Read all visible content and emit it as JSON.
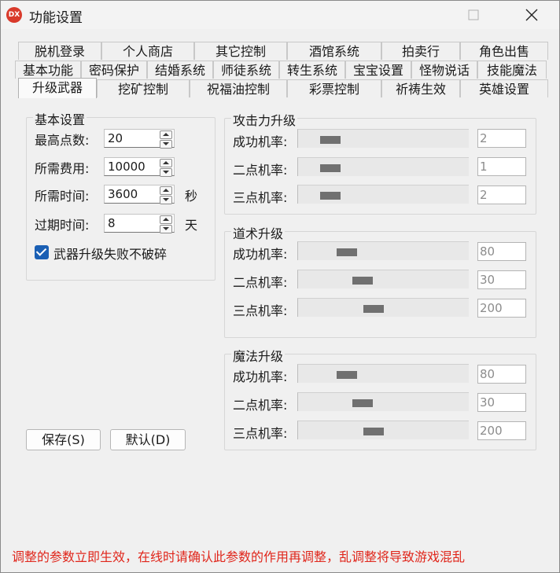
{
  "window": {
    "title": "功能设置",
    "icon_label": "DX"
  },
  "tabs": {
    "row1": [
      "脱机登录",
      "个人商店",
      "其它控制",
      "酒馆系统",
      "拍卖行",
      "角色出售"
    ],
    "row2": [
      "基本功能",
      "密码保护",
      "结婚系统",
      "师徒系统",
      "转生系统",
      "宝宝设置",
      "怪物说话",
      "技能魔法"
    ],
    "row3": [
      "升级武器",
      "挖矿控制",
      "祝福油控制",
      "彩票控制",
      "祈祷生效",
      "英雄设置"
    ],
    "active": "升级武器"
  },
  "basic": {
    "title": "基本设置",
    "fields": [
      {
        "label": "最高点数:",
        "value": "20",
        "unit": ""
      },
      {
        "label": "所需费用:",
        "value": "10000",
        "unit": ""
      },
      {
        "label": "所需时间:",
        "value": "3600",
        "unit": "秒"
      },
      {
        "label": "过期时间:",
        "value": "8",
        "unit": "天"
      }
    ],
    "checkbox_label": "武器升级失败不破碎",
    "checkbox_checked": true
  },
  "groups": [
    {
      "title": "攻击力升级",
      "rows": [
        {
          "label": "成功机率:",
          "value": "2",
          "level": 0.01
        },
        {
          "label": "二点机率:",
          "value": "1",
          "level": 0.005
        },
        {
          "label": "三点机率:",
          "value": "2",
          "level": 0.01
        }
      ]
    },
    {
      "title": "道术升级",
      "rows": [
        {
          "label": "成功机率:",
          "value": "80",
          "level": 0.3
        },
        {
          "label": "二点机率:",
          "value": "30",
          "level": 0.4
        },
        {
          "label": "三点机率:",
          "value": "200",
          "level": 0.5
        }
      ]
    },
    {
      "title": "魔法升级",
      "rows": [
        {
          "label": "成功机率:",
          "value": "80",
          "level": 0.3
        },
        {
          "label": "二点机率:",
          "value": "30",
          "level": 0.4
        },
        {
          "label": "三点机率:",
          "value": "200",
          "level": 0.5
        }
      ]
    }
  ],
  "buttons": {
    "save": "保存(S)",
    "default": "默认(D)"
  },
  "warning": "调整的参数立即生效，在线时请确认此参数的作用再调整，乱调整将导致游戏混乱",
  "colors": {
    "warning": "#e0261b",
    "checkbox": "#1a5fb4",
    "icon": "#d93a2b"
  }
}
